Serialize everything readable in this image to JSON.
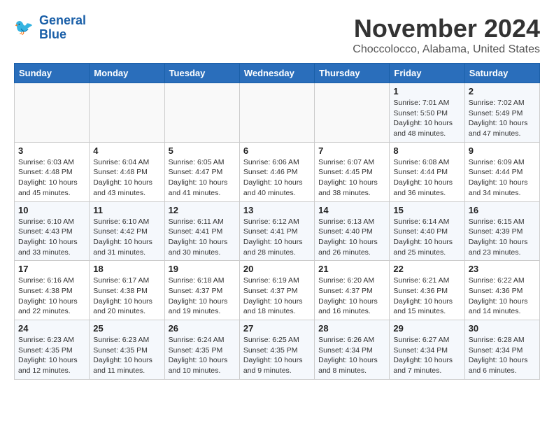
{
  "header": {
    "logo_line1": "General",
    "logo_line2": "Blue",
    "month": "November 2024",
    "location": "Choccolocco, Alabama, United States"
  },
  "days_of_week": [
    "Sunday",
    "Monday",
    "Tuesday",
    "Wednesday",
    "Thursday",
    "Friday",
    "Saturday"
  ],
  "weeks": [
    [
      {
        "day": "",
        "info": ""
      },
      {
        "day": "",
        "info": ""
      },
      {
        "day": "",
        "info": ""
      },
      {
        "day": "",
        "info": ""
      },
      {
        "day": "",
        "info": ""
      },
      {
        "day": "1",
        "info": "Sunrise: 7:01 AM\nSunset: 5:50 PM\nDaylight: 10 hours\nand 48 minutes."
      },
      {
        "day": "2",
        "info": "Sunrise: 7:02 AM\nSunset: 5:49 PM\nDaylight: 10 hours\nand 47 minutes."
      }
    ],
    [
      {
        "day": "3",
        "info": "Sunrise: 6:03 AM\nSunset: 4:48 PM\nDaylight: 10 hours\nand 45 minutes."
      },
      {
        "day": "4",
        "info": "Sunrise: 6:04 AM\nSunset: 4:48 PM\nDaylight: 10 hours\nand 43 minutes."
      },
      {
        "day": "5",
        "info": "Sunrise: 6:05 AM\nSunset: 4:47 PM\nDaylight: 10 hours\nand 41 minutes."
      },
      {
        "day": "6",
        "info": "Sunrise: 6:06 AM\nSunset: 4:46 PM\nDaylight: 10 hours\nand 40 minutes."
      },
      {
        "day": "7",
        "info": "Sunrise: 6:07 AM\nSunset: 4:45 PM\nDaylight: 10 hours\nand 38 minutes."
      },
      {
        "day": "8",
        "info": "Sunrise: 6:08 AM\nSunset: 4:44 PM\nDaylight: 10 hours\nand 36 minutes."
      },
      {
        "day": "9",
        "info": "Sunrise: 6:09 AM\nSunset: 4:44 PM\nDaylight: 10 hours\nand 34 minutes."
      }
    ],
    [
      {
        "day": "10",
        "info": "Sunrise: 6:10 AM\nSunset: 4:43 PM\nDaylight: 10 hours\nand 33 minutes."
      },
      {
        "day": "11",
        "info": "Sunrise: 6:10 AM\nSunset: 4:42 PM\nDaylight: 10 hours\nand 31 minutes."
      },
      {
        "day": "12",
        "info": "Sunrise: 6:11 AM\nSunset: 4:41 PM\nDaylight: 10 hours\nand 30 minutes."
      },
      {
        "day": "13",
        "info": "Sunrise: 6:12 AM\nSunset: 4:41 PM\nDaylight: 10 hours\nand 28 minutes."
      },
      {
        "day": "14",
        "info": "Sunrise: 6:13 AM\nSunset: 4:40 PM\nDaylight: 10 hours\nand 26 minutes."
      },
      {
        "day": "15",
        "info": "Sunrise: 6:14 AM\nSunset: 4:40 PM\nDaylight: 10 hours\nand 25 minutes."
      },
      {
        "day": "16",
        "info": "Sunrise: 6:15 AM\nSunset: 4:39 PM\nDaylight: 10 hours\nand 23 minutes."
      }
    ],
    [
      {
        "day": "17",
        "info": "Sunrise: 6:16 AM\nSunset: 4:38 PM\nDaylight: 10 hours\nand 22 minutes."
      },
      {
        "day": "18",
        "info": "Sunrise: 6:17 AM\nSunset: 4:38 PM\nDaylight: 10 hours\nand 20 minutes."
      },
      {
        "day": "19",
        "info": "Sunrise: 6:18 AM\nSunset: 4:37 PM\nDaylight: 10 hours\nand 19 minutes."
      },
      {
        "day": "20",
        "info": "Sunrise: 6:19 AM\nSunset: 4:37 PM\nDaylight: 10 hours\nand 18 minutes."
      },
      {
        "day": "21",
        "info": "Sunrise: 6:20 AM\nSunset: 4:37 PM\nDaylight: 10 hours\nand 16 minutes."
      },
      {
        "day": "22",
        "info": "Sunrise: 6:21 AM\nSunset: 4:36 PM\nDaylight: 10 hours\nand 15 minutes."
      },
      {
        "day": "23",
        "info": "Sunrise: 6:22 AM\nSunset: 4:36 PM\nDaylight: 10 hours\nand 14 minutes."
      }
    ],
    [
      {
        "day": "24",
        "info": "Sunrise: 6:23 AM\nSunset: 4:35 PM\nDaylight: 10 hours\nand 12 minutes."
      },
      {
        "day": "25",
        "info": "Sunrise: 6:23 AM\nSunset: 4:35 PM\nDaylight: 10 hours\nand 11 minutes."
      },
      {
        "day": "26",
        "info": "Sunrise: 6:24 AM\nSunset: 4:35 PM\nDaylight: 10 hours\nand 10 minutes."
      },
      {
        "day": "27",
        "info": "Sunrise: 6:25 AM\nSunset: 4:35 PM\nDaylight: 10 hours\nand 9 minutes."
      },
      {
        "day": "28",
        "info": "Sunrise: 6:26 AM\nSunset: 4:34 PM\nDaylight: 10 hours\nand 8 minutes."
      },
      {
        "day": "29",
        "info": "Sunrise: 6:27 AM\nSunset: 4:34 PM\nDaylight: 10 hours\nand 7 minutes."
      },
      {
        "day": "30",
        "info": "Sunrise: 6:28 AM\nSunset: 4:34 PM\nDaylight: 10 hours\nand 6 minutes."
      }
    ]
  ]
}
